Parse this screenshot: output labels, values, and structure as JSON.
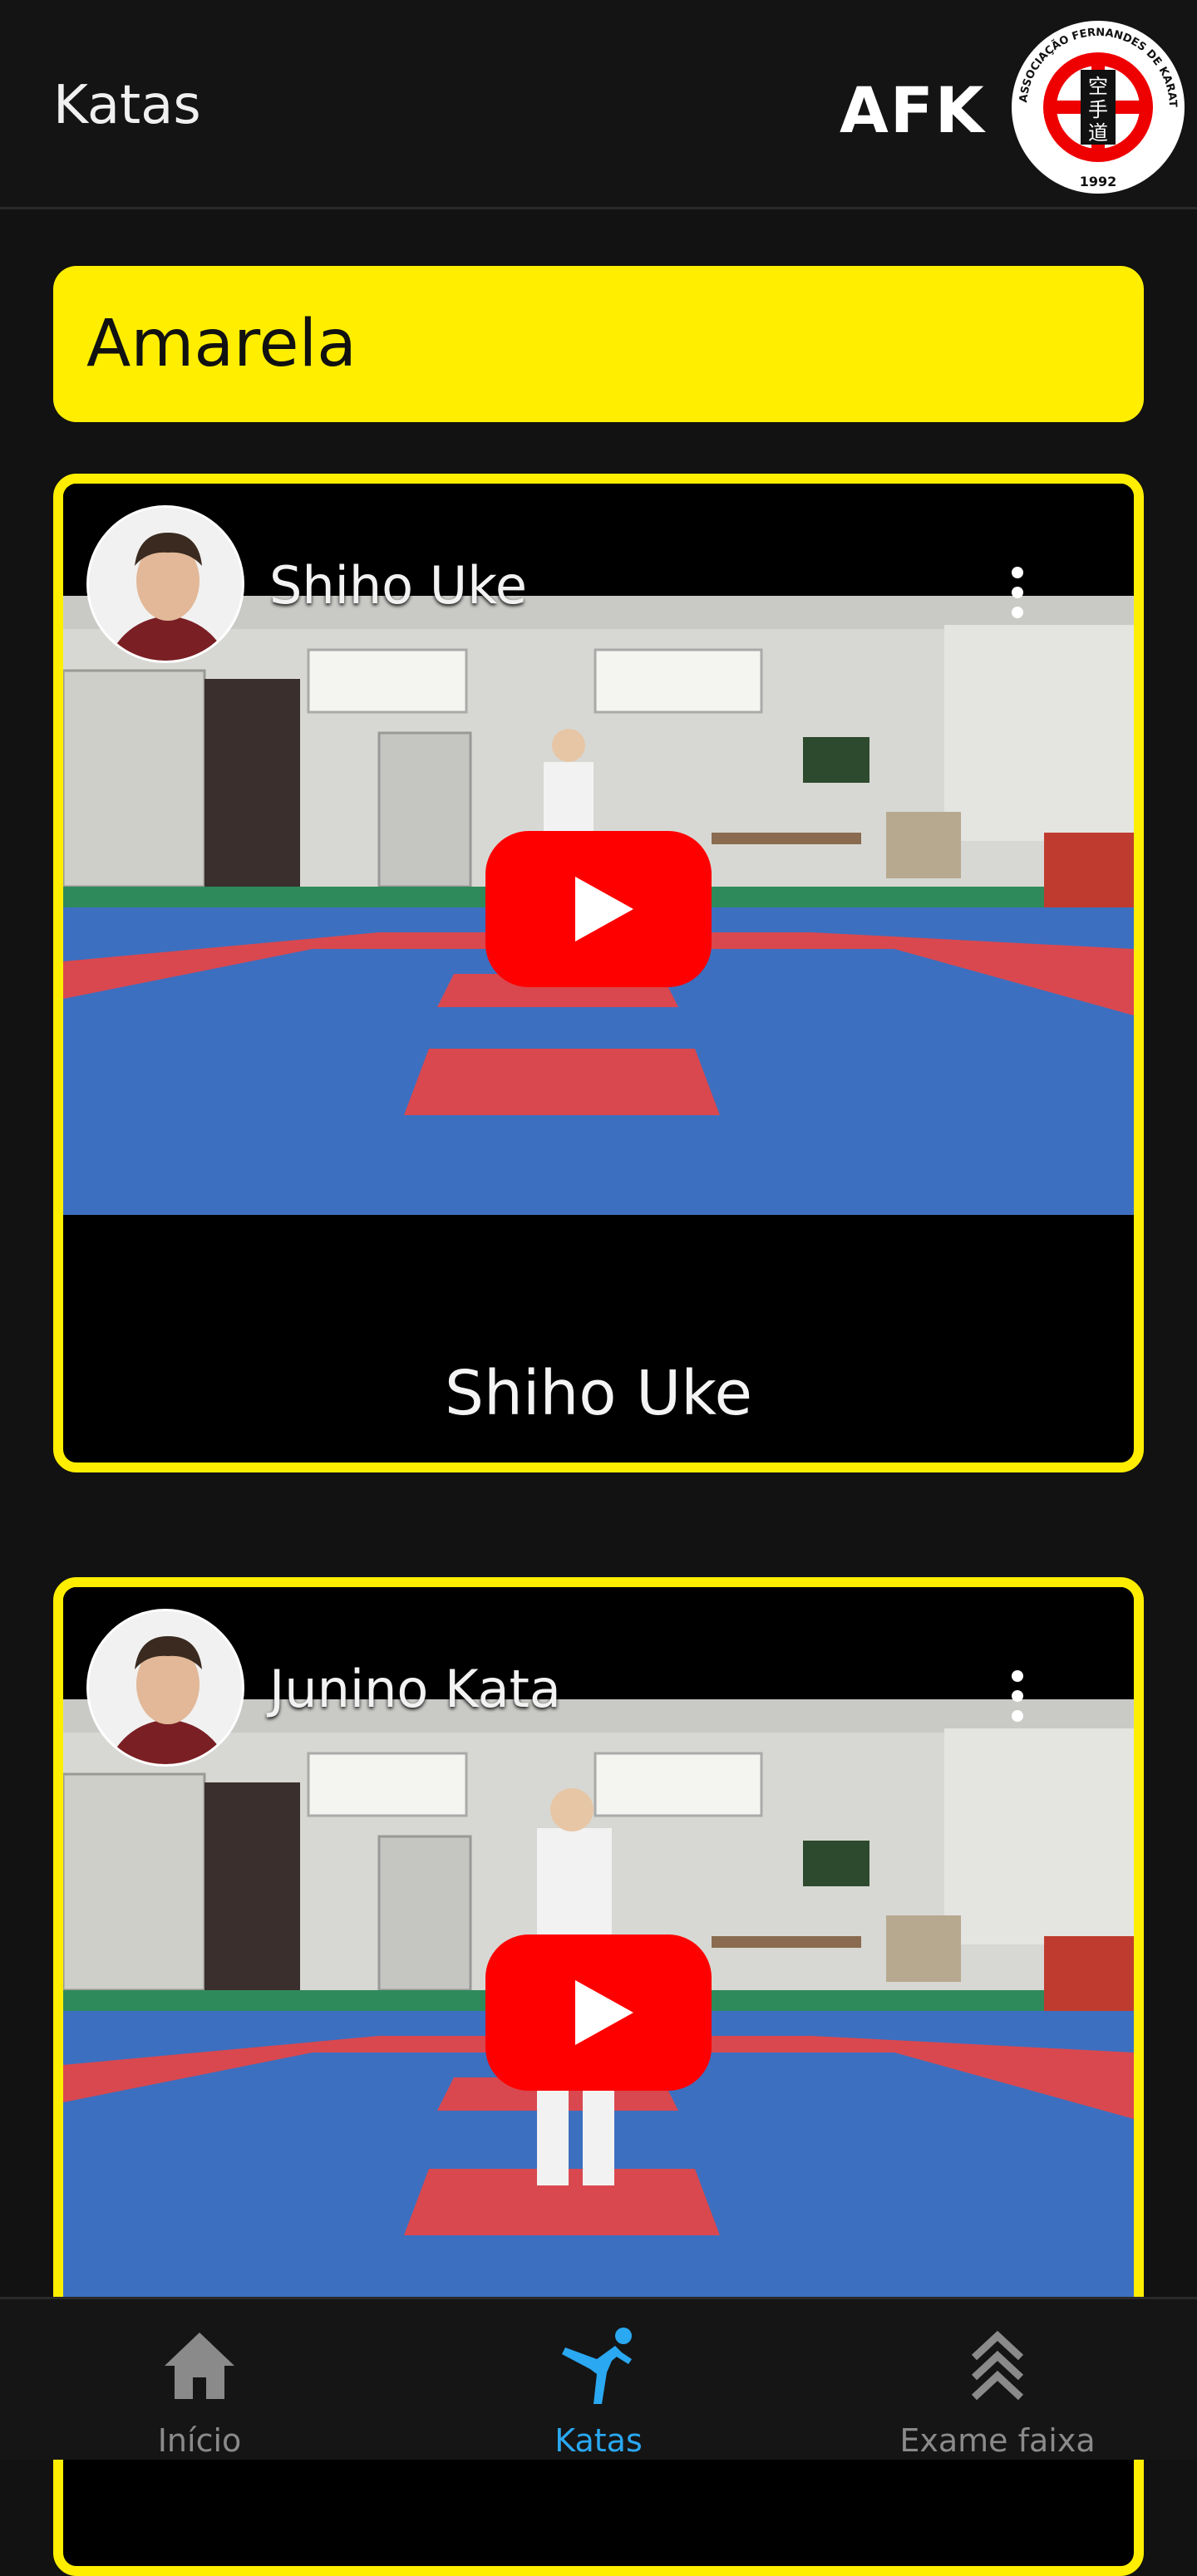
{
  "header": {
    "title": "Katas",
    "brand": "AFK",
    "logo": {
      "ring_text": "ASSOCIAÇÃO FERNANDES DE KARATE-DO",
      "year": "1992",
      "kanji": "空手道"
    }
  },
  "belt": {
    "label": "Amarela"
  },
  "videos": [
    {
      "title": "Shiho Uke",
      "caption": "Shiho Uke"
    },
    {
      "title": "Junino Kata",
      "caption": ""
    }
  ],
  "nav": {
    "items": [
      {
        "label": "Início",
        "icon": "home-icon",
        "active": false
      },
      {
        "label": "Katas",
        "icon": "karate-kick-icon",
        "active": true
      },
      {
        "label": "Exame faixa",
        "icon": "triple-chevron-up-icon",
        "active": false
      }
    ]
  },
  "colors": {
    "accent_yellow": "#ffee00",
    "active_blue": "#2aa8f2",
    "background": "#121212",
    "youtube_red": "#ff0000"
  }
}
